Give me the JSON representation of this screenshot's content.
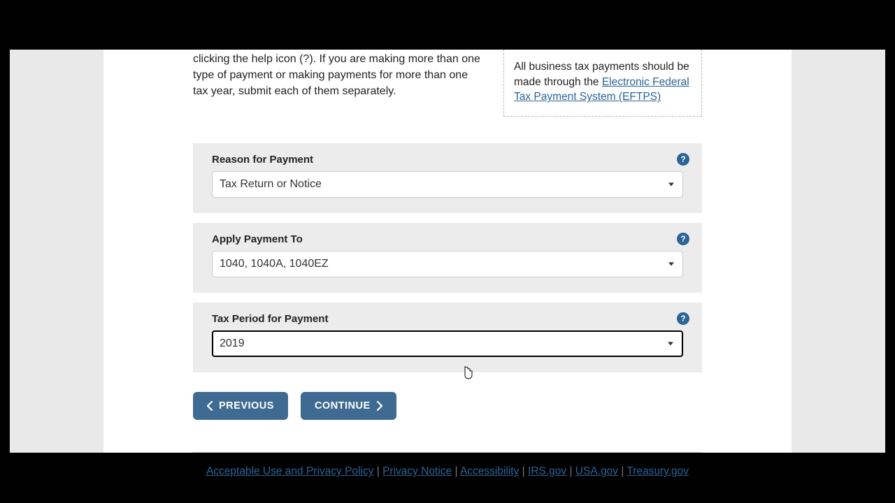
{
  "intro": {
    "fragment": "clicking the help icon (?). If you are making more than one type of payment or making payments for more than one tax year, submit each of them separately."
  },
  "callout": {
    "lead": "All business tax payments should be made through the ",
    "link_text": "Electronic Federal Tax Payment System (EFTPS)"
  },
  "fields": {
    "reason": {
      "label": "Reason for Payment",
      "value": "Tax Return or Notice"
    },
    "apply": {
      "label": "Apply Payment To",
      "value": "1040, 1040A, 1040EZ"
    },
    "period": {
      "label": "Tax Period for Payment",
      "value": "2019"
    }
  },
  "buttons": {
    "previous": "PREVIOUS",
    "continue": "CONTINUE"
  },
  "footer": {
    "links": {
      "acceptable": "Acceptable Use and Privacy Policy",
      "privacy": "Privacy Notice",
      "accessibility": "Accessibility",
      "irs": "IRS.gov",
      "usa": "USA.gov",
      "treasury": "Treasury.gov"
    },
    "sep": " | "
  },
  "help_glyph": "?"
}
